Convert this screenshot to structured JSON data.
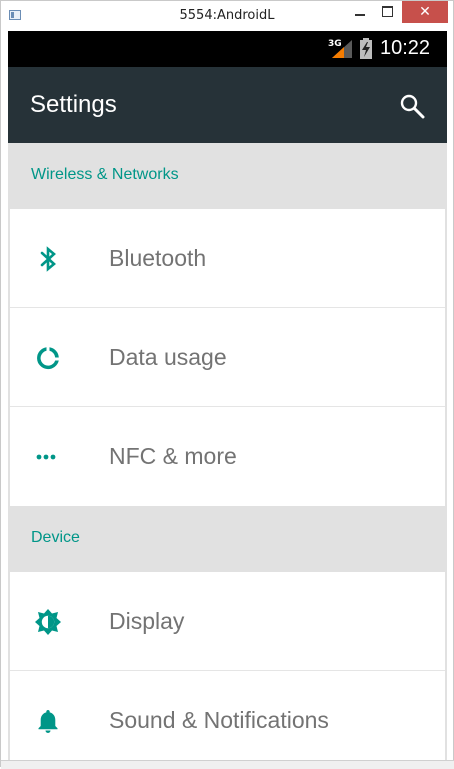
{
  "window": {
    "title": "5554:AndroidL",
    "min_label": "",
    "max_label": "",
    "close_label": "✕"
  },
  "statusbar": {
    "network": "3G",
    "clock": "10:22"
  },
  "appbar": {
    "title": "Settings",
    "search_icon": "search-icon"
  },
  "sections": [
    {
      "header": "Wireless & Networks",
      "items": [
        {
          "label": "Bluetooth",
          "icon": "bluetooth-icon"
        },
        {
          "label": "Data usage",
          "icon": "data-usage-icon"
        },
        {
          "label": "NFC & more",
          "icon": "more-dots-icon"
        }
      ]
    },
    {
      "header": "Device",
      "items": [
        {
          "label": "Display",
          "icon": "brightness-icon"
        },
        {
          "label": "Sound & Notifications",
          "icon": "bell-icon"
        }
      ]
    }
  ],
  "colors": {
    "accent": "#009688",
    "appbar": "#263238",
    "statusbar": "#000000",
    "background": "#e1e1e1",
    "close_button": "#c7504b"
  }
}
